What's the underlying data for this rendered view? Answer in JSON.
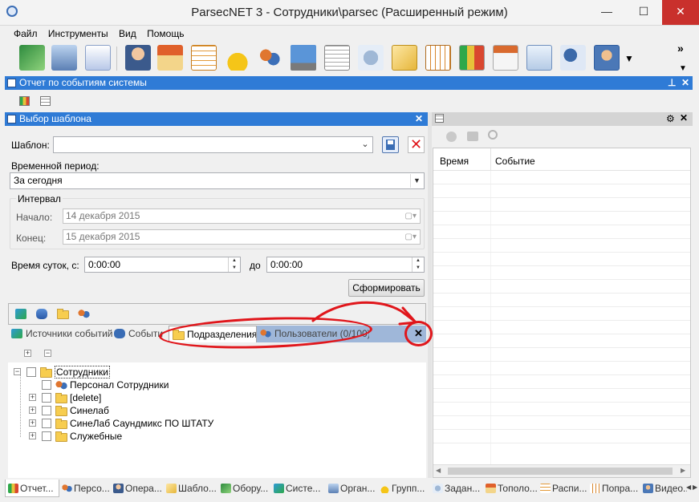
{
  "window": {
    "title": "ParsecNET 3 - Сотрудники\\parsec (Расширенный режим)",
    "minimize": "—",
    "maximize": "☐",
    "close": "✕"
  },
  "menu": [
    "Файл",
    "Инструменты",
    "Вид",
    "Помощь"
  ],
  "toolbar": {
    "overflow": "»",
    "icons": [
      "controller-board-icon",
      "building-icon",
      "checklist-icon",
      "person-icon",
      "house-icon",
      "calendar-grid-icon",
      "lock-icon",
      "users-icon",
      "monitor-icon",
      "schedule-icon",
      "gear-clock-icon",
      "cards-icon",
      "chart-table-icon",
      "bar-chart-icon",
      "calendar-chart-icon",
      "id-card-icon",
      "user-info-icon",
      "photo-id-icon"
    ]
  },
  "report_panel": {
    "title": "Отчет по событиям системы",
    "pin": "⊥",
    "close": "✕"
  },
  "template_panel": {
    "title": "Выбор шаблона",
    "close": "✕",
    "template_label": "Шаблон:",
    "template_value": "",
    "period_label": "Временной период:",
    "period_value": "За сегодня",
    "interval_title": "Интервал",
    "start_label": "Начало:",
    "start_value": "14 декабря  2015",
    "end_label": "Конец:",
    "end_value": "15 декабря  2015",
    "time_label": "Время суток, с:",
    "time_from": "0:00:00",
    "time_to_label": "до",
    "time_to": "0:00:00",
    "generate_button": "Сформировать"
  },
  "tabs": [
    {
      "label": "Источники событий"
    },
    {
      "label": "Событи"
    },
    {
      "label": "Подразделения"
    },
    {
      "label": "Пользователи (0/100)"
    }
  ],
  "tabs_close": "✕",
  "tree_toolbar": {
    "expand": "+",
    "collapse": "−"
  },
  "tree": {
    "root": "Сотрудники",
    "children": [
      {
        "label": "Персонал Сотрудники",
        "expandable": false,
        "icon": "person-icon"
      },
      {
        "label": "[delete]",
        "expandable": true
      },
      {
        "label": "Синелаб",
        "expandable": true
      },
      {
        "label": "СинеЛаб Саундмикс ПО ШТАТУ",
        "expandable": true
      },
      {
        "label": "Служебные",
        "expandable": true
      }
    ]
  },
  "right_panel": {
    "columns": [
      "Время",
      "Событие"
    ],
    "options": "⚙",
    "close": "✕"
  },
  "bottom_tabs": [
    "Отчет...",
    "Персо...",
    "Опера...",
    "Шабло...",
    "Обору...",
    "Систе...",
    "Орган...",
    "Групп...",
    "Задан...",
    "Тополо...",
    "Распи...",
    "Попра...",
    "Видео..."
  ],
  "bottom_nav": {
    "prev": "◀",
    "next": "▶"
  },
  "colors": {
    "accent_bar": "#2f7bd6",
    "annotation_red": "#e0161b",
    "folder": "#f7cd4f"
  }
}
